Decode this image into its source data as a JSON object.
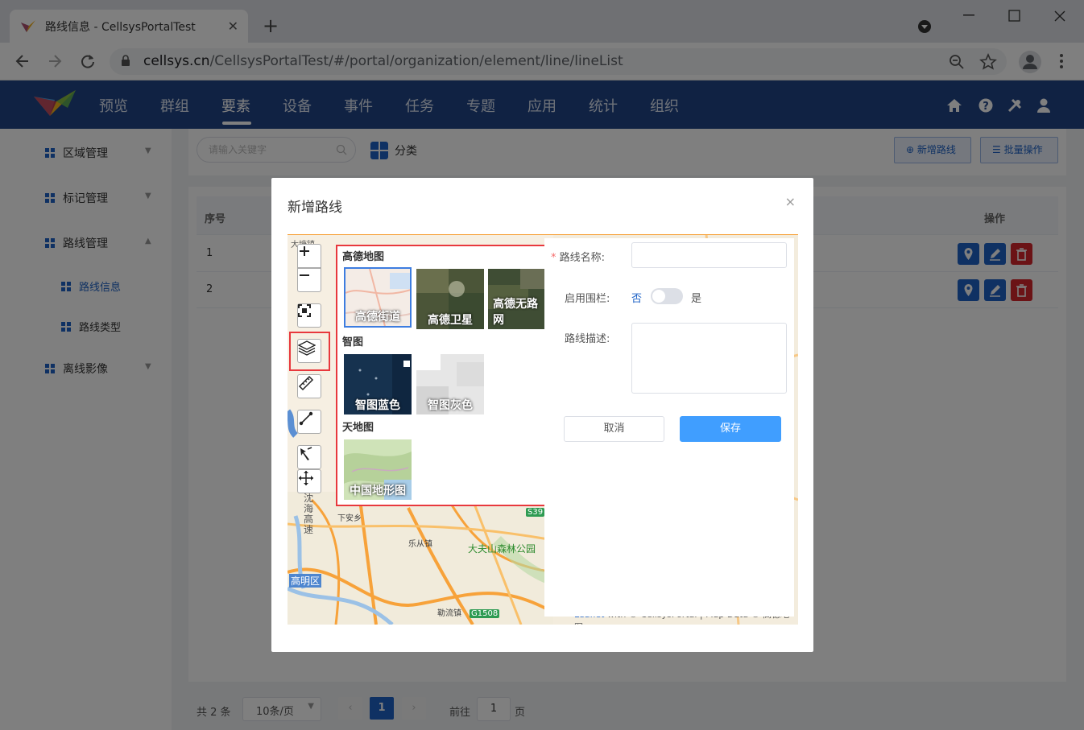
{
  "browser": {
    "tab_title": "路线信息 - CellsysPortalTest",
    "tab_close": "✕",
    "new_tab": "+",
    "url_host": "cellsys.cn",
    "url_path": "/CellsysPortalTest/#/portal/organization/element/line/lineList"
  },
  "nav": {
    "items": [
      "预览",
      "群组",
      "要素",
      "设备",
      "事件",
      "任务",
      "专题",
      "应用",
      "统计",
      "组织"
    ],
    "active": "要素"
  },
  "sidebar": {
    "items": [
      {
        "label": "区域管理"
      },
      {
        "label": "标记管理"
      },
      {
        "label": "路线管理"
      },
      {
        "label": "离线影像"
      }
    ],
    "sub_items": [
      {
        "label": "路线信息"
      },
      {
        "label": "路线类型"
      }
    ]
  },
  "toolbar": {
    "search_placeholder": "请输入关键字",
    "category_label": "分类",
    "add_label": "新增路线",
    "batch_label": "批量操作"
  },
  "table": {
    "headers": [
      "序号",
      "操作"
    ],
    "rows": [
      {
        "index": "1"
      },
      {
        "index": "2"
      }
    ]
  },
  "pager": {
    "total": "共 2 条",
    "page_size": "10条/页",
    "current_page": "1",
    "goto_prefix": "前往",
    "goto_value": "1",
    "goto_suffix": "页"
  },
  "modal": {
    "title": "新增路线",
    "close": "×",
    "layers": {
      "group1": "高德地图",
      "gaode_street": "高德街道",
      "gaode_sat": "高德卫星",
      "gaode_noroad": "高德无路网",
      "group2": "智图",
      "zhitu_blue": "智图蓝色",
      "zhitu_gray": "智图灰色",
      "group3": "天地图",
      "china_terrain": "中国地形图"
    },
    "map_labels": {
      "l1": "下安乡",
      "l2": "乐从镇",
      "l3": "大夫山森林公园",
      "l4": "高明区",
      "l5": "勒流镇",
      "l6": "S39",
      "l7": "G1508",
      "l8": "沈海高速",
      "l9": "大塘镇"
    },
    "form": {
      "name_label": "路线名称:",
      "fence_label": "启用围栏:",
      "fence_no": "否",
      "fence_yes": "是",
      "desc_label": "路线描述:",
      "cancel": "取消",
      "save": "保存"
    },
    "attribution_link": "Leaflet",
    "attribution_rest": " with © CellsysPortal | Map Data © 高德地图"
  },
  "colors": {
    "primary": "#1e62c6",
    "nav_bg": "#214587",
    "danger": "#d7262c",
    "save": "#409eff"
  }
}
